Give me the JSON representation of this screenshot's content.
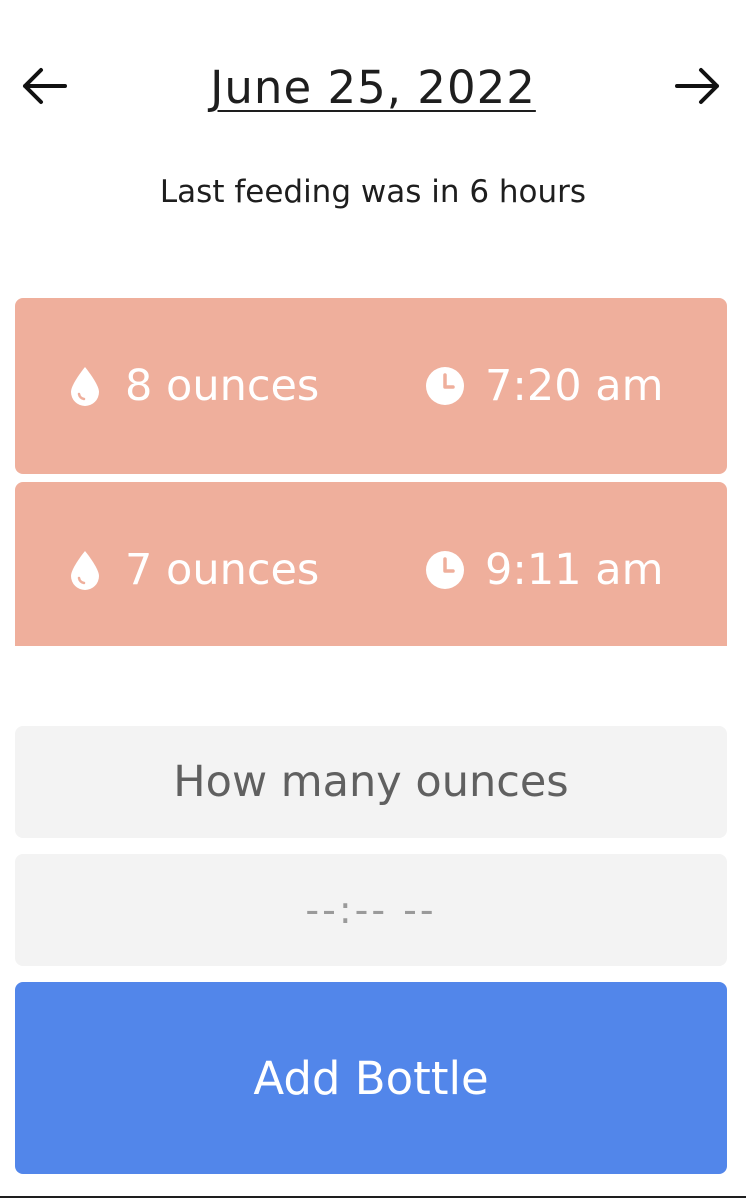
{
  "header": {
    "date": "June 25, 2022",
    "prev_icon": "arrow-left-icon",
    "next_icon": "arrow-right-icon"
  },
  "status": {
    "text": "Last feeding was in 6 hours"
  },
  "feedings": [
    {
      "amount": "8 ounces",
      "time": "7:20 am"
    },
    {
      "amount": "7 ounces",
      "time": "9:11 am"
    }
  ],
  "form": {
    "ounces_placeholder": "How many ounces",
    "time_placeholder": "--:-- --",
    "add_label": "Add Bottle"
  },
  "colors": {
    "card": "#efaf9c",
    "input_bg": "#f3f3f3",
    "accent": "#5286ea"
  },
  "icons": {
    "amount": "droplet-icon",
    "time": "clock-icon"
  }
}
